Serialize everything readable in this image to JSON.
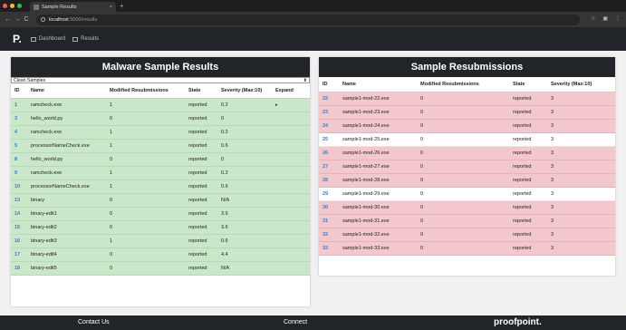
{
  "browser": {
    "tab_title": "Sample Results",
    "tab_close": "×",
    "new_tab": "+",
    "host": "localhost",
    "path": ":5000/results",
    "back": "←",
    "forward": "→",
    "reload": "C",
    "icons": [
      "star-icon",
      "extensions-icon",
      "menu-icon"
    ],
    "traffic_colors": [
      "#ff5f57",
      "#febc2e",
      "#28c840"
    ]
  },
  "navbar": {
    "logo": "P.",
    "links": [
      {
        "label": "Dashboard",
        "icon": "dashboard-icon"
      },
      {
        "label": "Results",
        "icon": "results-icon"
      }
    ]
  },
  "left_panel": {
    "title": "Malware Sample Results",
    "select_value": "Clean Samples",
    "columns": [
      "ID",
      "Name",
      "Modified Resubmissions",
      "State",
      "Severity (Max:10)",
      "Expand"
    ],
    "rows": [
      {
        "id": "1",
        "name": "ramcheck.exe",
        "mods": "1",
        "state": "reported",
        "severity": "0.2",
        "expand": "▸"
      },
      {
        "id": "3",
        "name": "hello_world.py",
        "mods": "0",
        "state": "reported",
        "severity": "0",
        "expand": ""
      },
      {
        "id": "4",
        "name": "ramcheck.exe",
        "mods": "1",
        "state": "reported",
        "severity": "0.2",
        "expand": ""
      },
      {
        "id": "5",
        "name": "processorNameCheck.exe",
        "mods": "1",
        "state": "reported",
        "severity": "0.6",
        "expand": ""
      },
      {
        "id": "8",
        "name": "hello_world.py",
        "mods": "0",
        "state": "reported",
        "severity": "0",
        "expand": ""
      },
      {
        "id": "9",
        "name": "ramcheck.exe",
        "mods": "1",
        "state": "reported",
        "severity": "0.2",
        "expand": ""
      },
      {
        "id": "10",
        "name": "processorNameCheck.exe",
        "mods": "1",
        "state": "reported",
        "severity": "0.6",
        "expand": ""
      },
      {
        "id": "13",
        "name": "binary",
        "mods": "0",
        "state": "reported",
        "severity": "N/A",
        "expand": ""
      },
      {
        "id": "14",
        "name": "binary-edit1",
        "mods": "0",
        "state": "reported",
        "severity": "3.6",
        "expand": ""
      },
      {
        "id": "15",
        "name": "binary-edit2",
        "mods": "0",
        "state": "reported",
        "severity": "3.6",
        "expand": ""
      },
      {
        "id": "16",
        "name": "binary-edit3",
        "mods": "1",
        "state": "reported",
        "severity": "0.6",
        "expand": ""
      },
      {
        "id": "17",
        "name": "binary-edit4",
        "mods": "0",
        "state": "reported",
        "severity": "4.4",
        "expand": ""
      },
      {
        "id": "18",
        "name": "binary-edit5",
        "mods": "0",
        "state": "reported",
        "severity": "N/A",
        "expand": ""
      }
    ]
  },
  "right_panel": {
    "title": "Sample Resubmissions",
    "columns": [
      "ID",
      "Name",
      "Modified Resubmissions",
      "State",
      "Severity (Max:10)"
    ],
    "rows": [
      {
        "id": "22",
        "name": "sample1-mod-22.exe",
        "mods": "0",
        "state": "reported",
        "severity": "3",
        "flag": "red"
      },
      {
        "id": "23",
        "name": "sample1-mod-23.exe",
        "mods": "0",
        "state": "reported",
        "severity": "3",
        "flag": "red"
      },
      {
        "id": "24",
        "name": "sample1-mod-24.exe",
        "mods": "0",
        "state": "reported",
        "severity": "3",
        "flag": "red"
      },
      {
        "id": "25",
        "name": "sample1-mod-25.exe",
        "mods": "0",
        "state": "reported",
        "severity": "3",
        "flag": "white"
      },
      {
        "id": "26",
        "name": "sample1-mod-26.exe",
        "mods": "0",
        "state": "reported",
        "severity": "3",
        "flag": "red"
      },
      {
        "id": "27",
        "name": "sample1-mod-27.exe",
        "mods": "0",
        "state": "reported",
        "severity": "3",
        "flag": "red"
      },
      {
        "id": "28",
        "name": "sample1-mod-28.exe",
        "mods": "0",
        "state": "reported",
        "severity": "3",
        "flag": "red"
      },
      {
        "id": "29",
        "name": "sample1-mod-29.exe",
        "mods": "0",
        "state": "reported",
        "severity": "3",
        "flag": "white"
      },
      {
        "id": "30",
        "name": "sample1-mod-30.exe",
        "mods": "0",
        "state": "reported",
        "severity": "3",
        "flag": "red"
      },
      {
        "id": "31",
        "name": "sample1-mod-31.exe",
        "mods": "0",
        "state": "reported",
        "severity": "3",
        "flag": "red"
      },
      {
        "id": "32",
        "name": "sample1-mod-32.exe",
        "mods": "0",
        "state": "reported",
        "severity": "3",
        "flag": "red"
      },
      {
        "id": "33",
        "name": "sample1-mod-33.exe",
        "mods": "0",
        "state": "reported",
        "severity": "3",
        "flag": "red"
      }
    ]
  },
  "footer": {
    "contact": "Contact Us",
    "connect": "Connect",
    "brand": "proofpoint."
  },
  "colors": {
    "clean_row": "#c9e7c9",
    "flagged_row": "#f3c8cc",
    "id_link": "#2f7ed8",
    "dark": "#212529"
  }
}
